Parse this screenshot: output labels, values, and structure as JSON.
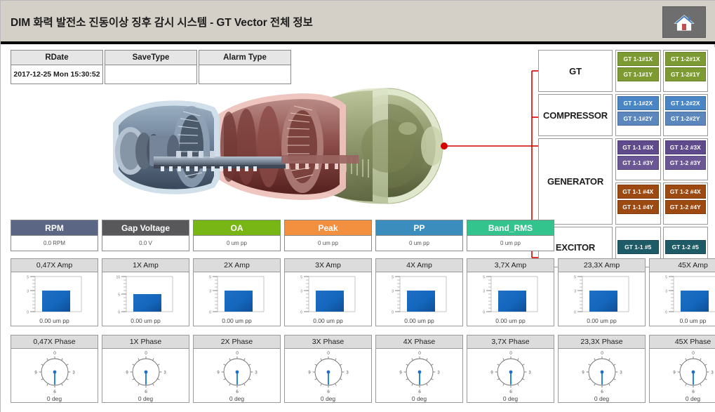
{
  "window": {
    "title": "DIM  화력 발전소 진동이상 징후 감시 시스템 - GT Vector 전체 정보",
    "home_button_label": "home-icon"
  },
  "info_fields": [
    {
      "label": "RDate",
      "value": "2017-12-25 Mon 15:30:52"
    },
    {
      "label": "SaveType",
      "value": ""
    },
    {
      "label": "Alarm Type",
      "value": ""
    }
  ],
  "equipment_panel": {
    "rows": [
      {
        "name": "GT",
        "color": "#7d9b32",
        "groups": [
          {
            "tags": [
              "GT 1-1#1X",
              "GT 1-1#1Y"
            ]
          },
          {
            "tags": [
              "GT 1-2#1X",
              "GT 1-2#1Y"
            ]
          }
        ]
      },
      {
        "name": "COMPRESSOR",
        "color": "#4a86c5",
        "groups": [
          {
            "tags": [
              "GT 1-1#2X",
              "GT 1-1#2Y"
            ]
          },
          {
            "tags": [
              "GT 1-2#2X",
              "GT 1-2#2Y"
            ]
          }
        ]
      },
      {
        "name": "GENERATOR",
        "subrows": [
          {
            "color": "#5f4b8b",
            "groups": [
              {
                "tags": [
                  "GT 1-1 #3X",
                  "GT 1-1 #3Y"
                ]
              },
              {
                "tags": [
                  "GT 1-2 #3X",
                  "GT 1-2 #3Y"
                ]
              }
            ]
          },
          {
            "color": "#9c4a11",
            "groups": [
              {
                "tags": [
                  "GT 1-1 #4X",
                  "GT 1-1 #4Y"
                ]
              },
              {
                "tags": [
                  "GT 1-2 #4X",
                  "GT 1-2 #4Y"
                ]
              }
            ]
          }
        ]
      },
      {
        "name": "EXCITOR",
        "color": "#1d5b66",
        "groups": [
          {
            "tags": [
              "GT 1-1 #5"
            ]
          },
          {
            "tags": [
              "GT 1-2 #5"
            ]
          }
        ]
      }
    ]
  },
  "metrics": [
    {
      "label": "RPM",
      "value": "0.0 RPM",
      "color": "#5b6584"
    },
    {
      "label": "Gap Voltage",
      "value": "0.0 V",
      "color": "#58585a"
    },
    {
      "label": "OA",
      "value": "0 um pp",
      "color": "#77b615"
    },
    {
      "label": "Peak",
      "value": "0 um pp",
      "color": "#f29040"
    },
    {
      "label": "PP",
      "value": "0 um pp",
      "color": "#3b8dbd"
    },
    {
      "label": "Band_RMS",
      "value": "0 um pp",
      "color": "#33c48d"
    }
  ],
  "chart_data": [
    {
      "type": "bar",
      "title": "0,47X Amp",
      "caption": "0.00 um pp",
      "categories": [
        "0,47X"
      ],
      "values": [
        3
      ],
      "ylim": [
        0,
        5
      ],
      "yticks": [
        0,
        3,
        5
      ],
      "ylabel": "",
      "xlabel": "",
      "grid": false
    },
    {
      "type": "bar",
      "title": "1X Amp",
      "caption": "0.00 um pp",
      "categories": [
        "1X"
      ],
      "values": [
        5
      ],
      "ylim": [
        0,
        10
      ],
      "yticks": [
        0,
        5,
        10
      ],
      "ylabel": "",
      "xlabel": "",
      "grid": false
    },
    {
      "type": "bar",
      "title": "2X Amp",
      "caption": "0.00 um pp",
      "categories": [
        "2X"
      ],
      "values": [
        3
      ],
      "ylim": [
        0,
        5
      ],
      "yticks": [
        0,
        3,
        5
      ],
      "ylabel": "",
      "xlabel": "",
      "grid": false
    },
    {
      "type": "bar",
      "title": "3X Amp",
      "caption": "0.00 um pp",
      "categories": [
        "3X"
      ],
      "values": [
        3
      ],
      "ylim": [
        0,
        5
      ],
      "yticks": [
        0,
        3,
        5
      ],
      "ylabel": "",
      "xlabel": "",
      "grid": false
    },
    {
      "type": "bar",
      "title": "4X Amp",
      "caption": "0.00 um pp",
      "categories": [
        "4X"
      ],
      "values": [
        3
      ],
      "ylim": [
        0,
        5
      ],
      "yticks": [
        0,
        3,
        5
      ],
      "ylabel": "",
      "xlabel": "",
      "grid": false
    },
    {
      "type": "bar",
      "title": "3,7X Amp",
      "caption": "0.00 um pp",
      "categories": [
        "3,7X"
      ],
      "values": [
        3
      ],
      "ylim": [
        0,
        5
      ],
      "yticks": [
        0,
        3,
        5
      ],
      "ylabel": "",
      "xlabel": "",
      "grid": false
    },
    {
      "type": "bar",
      "title": "23,3X Amp",
      "caption": "0.00 um pp",
      "categories": [
        "23,3X"
      ],
      "values": [
        3
      ],
      "ylim": [
        0,
        5
      ],
      "yticks": [
        0,
        3,
        5
      ],
      "ylabel": "",
      "xlabel": "",
      "grid": false
    },
    {
      "type": "bar",
      "title": "45X Amp",
      "caption": "0.0 um pp",
      "categories": [
        "45X"
      ],
      "values": [
        3
      ],
      "ylim": [
        0,
        5
      ],
      "yticks": [
        0,
        3,
        5
      ],
      "ylabel": "",
      "xlabel": "",
      "grid": false
    },
    {
      "type": "gauge",
      "title": "0,47X Phase",
      "caption": "0 deg",
      "value": 0,
      "unit": "deg",
      "dial_labels": {
        "top": "0",
        "right": "3",
        "bottom": "6",
        "left": "9"
      },
      "range": [
        0,
        12
      ]
    },
    {
      "type": "gauge",
      "title": "1X Phase",
      "caption": "0 deg",
      "value": 0,
      "unit": "deg",
      "dial_labels": {
        "top": "0",
        "right": "3",
        "bottom": "6",
        "left": "9"
      },
      "range": [
        0,
        12
      ]
    },
    {
      "type": "gauge",
      "title": "2X Phase",
      "caption": "0 deg",
      "value": 0,
      "unit": "deg",
      "dial_labels": {
        "top": "0",
        "right": "3",
        "bottom": "6",
        "left": "9"
      },
      "range": [
        0,
        12
      ]
    },
    {
      "type": "gauge",
      "title": "3X Phase",
      "caption": "0 deg",
      "value": 0,
      "unit": "deg",
      "dial_labels": {
        "top": "0",
        "right": "3",
        "bottom": "6",
        "left": "9"
      },
      "range": [
        0,
        12
      ]
    },
    {
      "type": "gauge",
      "title": "4X Phase",
      "caption": "0 deg",
      "value": 0,
      "unit": "deg",
      "dial_labels": {
        "top": "0",
        "right": "3",
        "bottom": "6",
        "left": "9"
      },
      "range": [
        0,
        12
      ]
    },
    {
      "type": "gauge",
      "title": "3,7X Phase",
      "caption": "0 deg",
      "value": 0,
      "unit": "deg",
      "dial_labels": {
        "top": "0",
        "right": "3",
        "bottom": "6",
        "left": "9"
      },
      "range": [
        0,
        12
      ]
    },
    {
      "type": "gauge",
      "title": "23,3X Phase",
      "caption": "0 deg",
      "value": 0,
      "unit": "deg",
      "dial_labels": {
        "top": "0",
        "right": "3",
        "bottom": "6",
        "left": "9"
      },
      "range": [
        0,
        12
      ]
    },
    {
      "type": "gauge",
      "title": "45X Phase",
      "caption": "0 deg",
      "value": 0,
      "unit": "deg",
      "dial_labels": {
        "top": "0",
        "right": "3",
        "bottom": "6",
        "left": "9"
      },
      "range": [
        0,
        12
      ]
    }
  ],
  "diagram": {
    "turbine_label": "gas-turbine-cutaway",
    "connector_color": "#d40000"
  }
}
